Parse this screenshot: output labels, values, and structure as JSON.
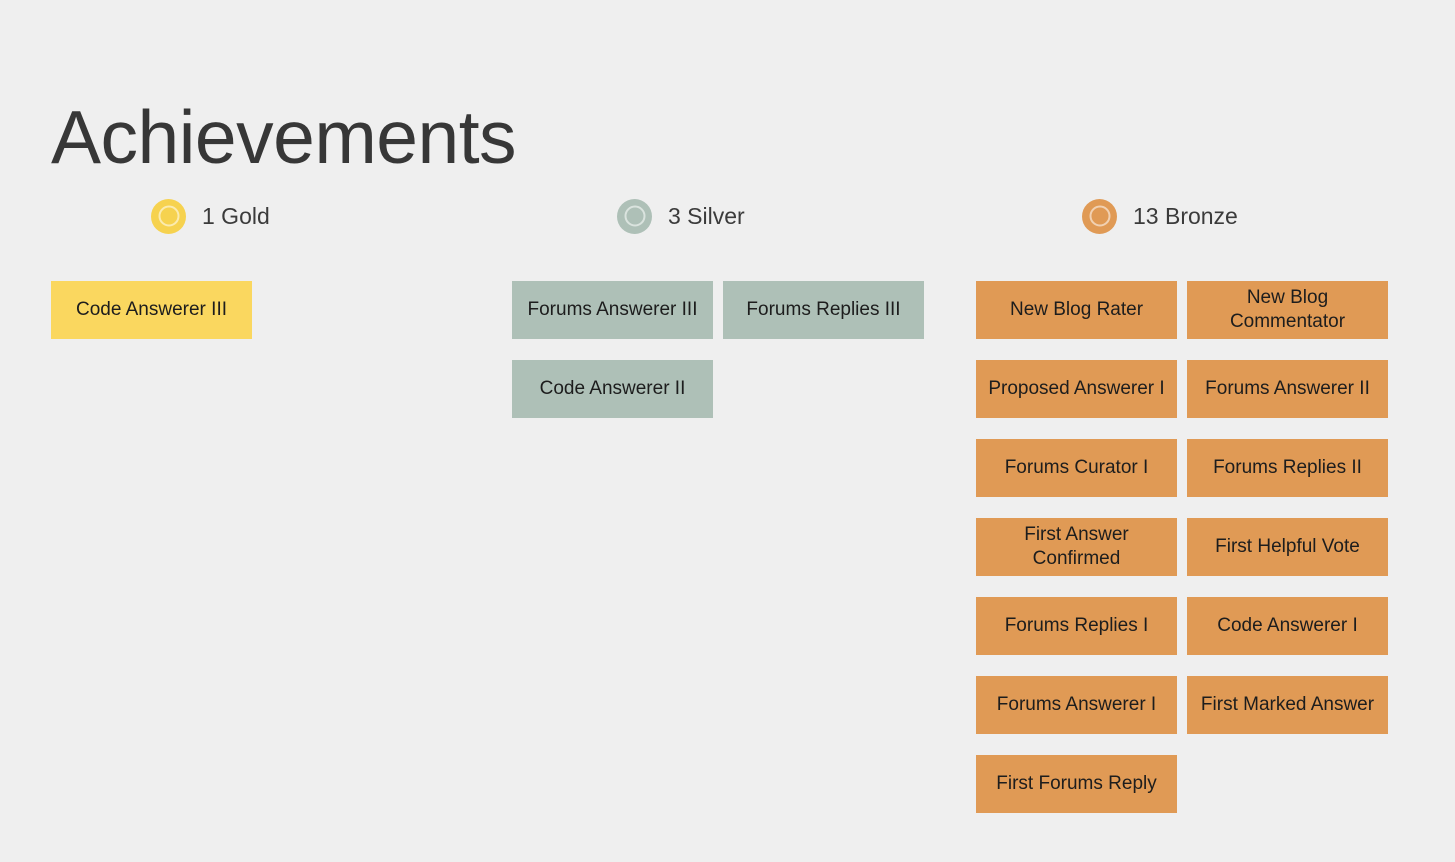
{
  "page": {
    "title": "Achievements",
    "background_color": "#efefef",
    "title_color": "#373737"
  },
  "columns": [
    {
      "key": "gold",
      "medal_icon": "gold-medal-icon",
      "medal_color": "#f6d24f",
      "tile_color": "#fad75f",
      "count": 1,
      "label": "1 Gold",
      "badges": [
        "Code Answerer III"
      ]
    },
    {
      "key": "silver",
      "medal_icon": "silver-medal-icon",
      "medal_color": "#aec0b7",
      "tile_color": "#aec0b7",
      "count": 3,
      "label": "3 Silver",
      "badges": [
        "Forums Answerer III",
        "Forums Replies III",
        "Code Answerer II"
      ]
    },
    {
      "key": "bronze",
      "medal_icon": "bronze-medal-icon",
      "medal_color": "#e09a55",
      "tile_color": "#e09a55",
      "count": 13,
      "label": "13 Bronze",
      "badges": [
        "New Blog Rater",
        "New Blog Commentator",
        "Proposed Answerer I",
        "Forums Answerer II",
        "Forums Curator I",
        "Forums Replies II",
        "First Answer Confirmed",
        "First Helpful Vote",
        "Forums Replies I",
        "Code Answerer I",
        "Forums Answerer I",
        "First Marked Answer",
        "First Forums Reply"
      ]
    }
  ]
}
